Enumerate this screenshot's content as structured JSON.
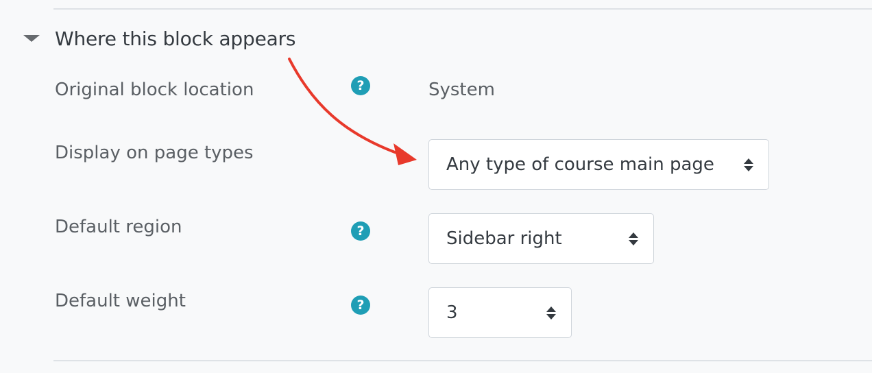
{
  "section": {
    "title": "Where this block appears"
  },
  "fields": {
    "original_location": {
      "label": "Original block location",
      "value": "System",
      "help_icon": "?"
    },
    "page_types": {
      "label": "Display on page types",
      "value": "Any type of course main page"
    },
    "default_region": {
      "label": "Default region",
      "value": "Sidebar right",
      "help_icon": "?"
    },
    "default_weight": {
      "label": "Default weight",
      "value": "3",
      "help_icon": "?"
    }
  },
  "colors": {
    "help_icon": "#1f9eb5",
    "annotation_arrow": "#e8392b"
  }
}
